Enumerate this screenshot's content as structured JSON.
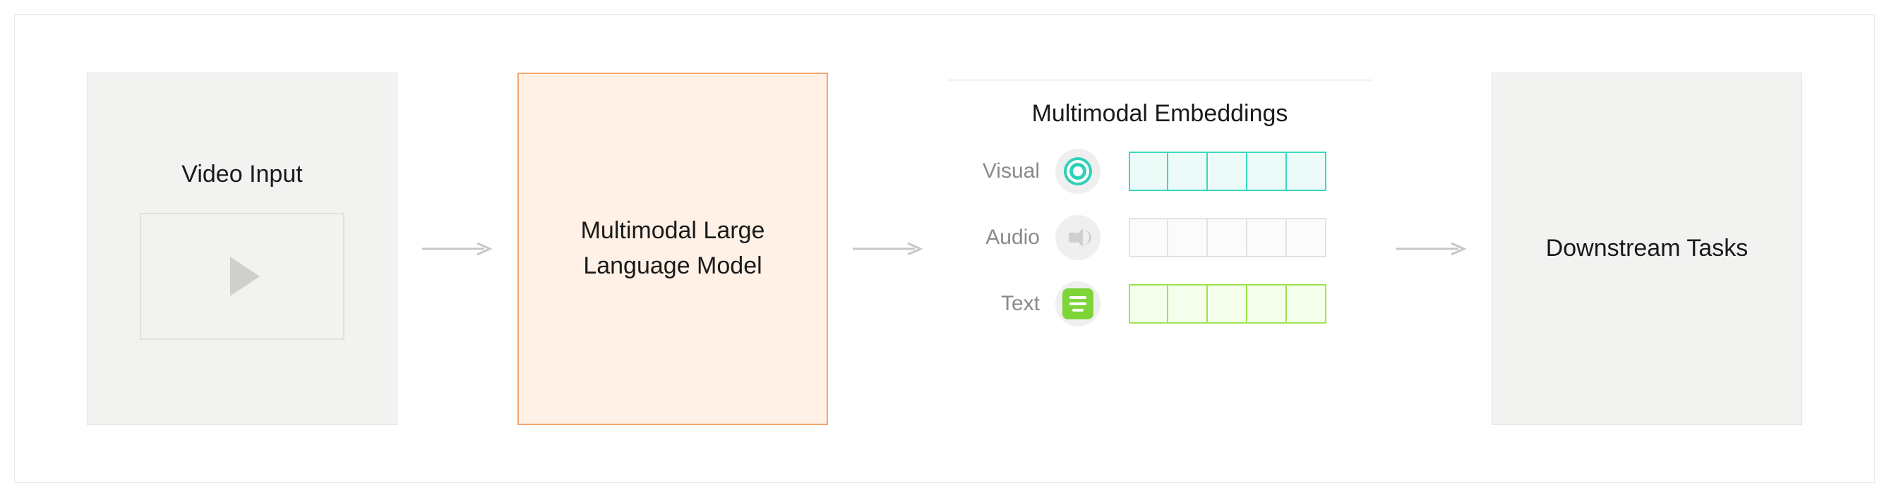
{
  "diagram": {
    "video_input": {
      "title": "Video Input"
    },
    "mllm": {
      "title_line1": "Multimodal Large",
      "title_line2": "Language Model"
    },
    "embeddings": {
      "title": "Multimodal Embeddings",
      "rows": [
        {
          "label": "Visual",
          "icon": "eye-icon",
          "style": "visual",
          "cells": 5
        },
        {
          "label": "Audio",
          "icon": "speaker-icon",
          "style": "audio",
          "cells": 5
        },
        {
          "label": "Text",
          "icon": "text-icon",
          "style": "text",
          "cells": 5
        }
      ]
    },
    "downstream": {
      "title": "Downstream Tasks"
    }
  }
}
